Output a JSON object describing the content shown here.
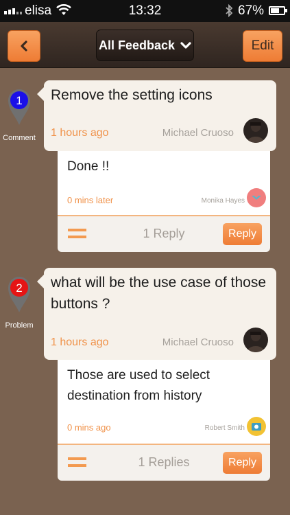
{
  "statusbar": {
    "carrier": "elisa",
    "time": "13:32",
    "battery": "67%",
    "battery_level": 0.67
  },
  "nav": {
    "title": "All Feedback",
    "edit_label": "Edit"
  },
  "colors": {
    "accent": "#F0924A",
    "background": "#7A6250",
    "comment_pin": "#1A10E8",
    "problem_pin": "#E51515"
  },
  "items": [
    {
      "number": "1",
      "type": "Comment",
      "text": "Remove the setting icons",
      "time": "1 hours ago",
      "author": "Michael Cruoso",
      "reply": {
        "text": "Done !!",
        "time": "0 mins later",
        "author": "Monika Hayes"
      },
      "reply_count": "1 Reply",
      "reply_button": "Reply"
    },
    {
      "number": "2",
      "type": "Problem",
      "text": "what will be the use case of those buttons ?",
      "time": "1 hours ago",
      "author": "Michael Cruoso",
      "reply": {
        "text": "Those are used to select destination from history",
        "time": "0 mins ago",
        "author": "Robert Smith"
      },
      "reply_count": "1 Replies",
      "reply_button": "Reply"
    }
  ]
}
